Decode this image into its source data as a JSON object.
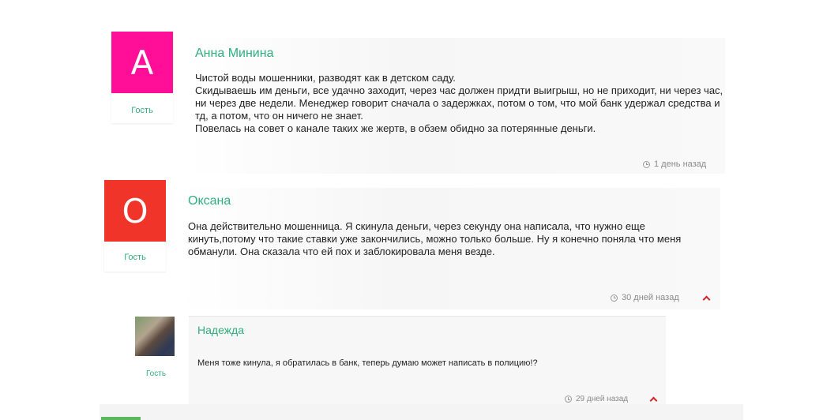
{
  "comments": [
    {
      "author": "Анна Минина",
      "avatar_letter": "A",
      "avatar_color": "#ff0e97",
      "role": "Гость",
      "text": "Чистой воды мошенники, разводят как в детском саду.\nСкидываешь им деньги, все удачно заходит, через час должен придти выигрыш, но не приходит, ни через час, ни через две недели. Менеджер говорит сначала о задержках, потом о том, что мой банк удержал средства и тд, а потом, что он ничего не знает.\nПовелась на совет о канале таких же жертв, в обзем обидно за потерянные деньги.",
      "time": "1 день назад"
    },
    {
      "author": "Оксана",
      "avatar_letter": "O",
      "avatar_color": "#f0342a",
      "role": "Гость",
      "text": "Она действительно мошенница. Я скинула деньги, через секунду она написала, что нужно еще кинуть,потому что такие ставки уже закончились, можно только больше. Ну я конечно поняла что меня обманули. Она сказала что ей пох и заблокировала меня везде.",
      "time": "30 дней назад"
    },
    {
      "author": "Надежда",
      "avatar": "photo",
      "role": "Гость",
      "text": "Меня тоже кинула, я обратилась в банк, теперь думаю может написать в полицию!?",
      "time": "29 дней назад"
    }
  ],
  "colors": {
    "accent_green": "#2eaf7d",
    "reply_arrow": "#d0242a"
  }
}
